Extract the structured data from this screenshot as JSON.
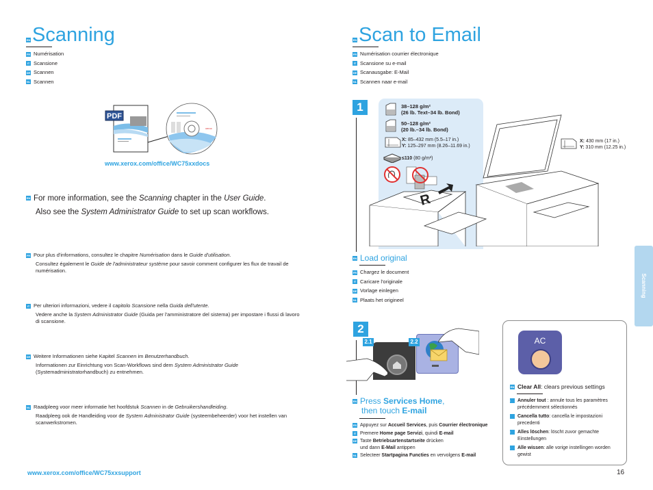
{
  "left": {
    "title_lang": "EN",
    "title": "Scanning",
    "translations": [
      {
        "lang": "FR",
        "text": "Numérisation"
      },
      {
        "lang": "IT",
        "text": "Scansione"
      },
      {
        "lang": "DE",
        "text": "Scannen"
      },
      {
        "lang": "NL",
        "text": "Scannen"
      }
    ],
    "pdf_label": "PDF",
    "docs_link": "www.xerox.com/office/WC75xxdocs",
    "info_en": {
      "lang": "EN",
      "line1_a": "For more information, see the ",
      "line1_i1": "Scanning",
      "line1_b": " chapter in the ",
      "line1_i2": "User Guide",
      "line1_c": ".",
      "line2_a": "Also see the ",
      "line2_i": "System Administrator Guide",
      "line2_b": " to set up scan workflows."
    },
    "info_fr": {
      "lang": "FR",
      "l1a": "Pour plus d'informations, consultez le chapitre ",
      "l1i1": "Numérisation",
      "l1b": " dans le ",
      "l1i2": "Guide d'utilisation",
      "l1c": ".",
      "l2a": "Consultez également le ",
      "l2i": "Guide de l'administrateur système",
      "l2b": " pour savoir comment configurer les flux de travail de numérisation."
    },
    "info_it": {
      "lang": "IT",
      "l1a": "Per ulteriori informazioni, vedere il capitolo ",
      "l1i1": "Scansione",
      "l1b": " nella ",
      "l1i2": "Guida dell'utente",
      "l1c": ".",
      "l2a": "Vedere anche la ",
      "l2i": "System Administrator Guide",
      "l2b": " (Guida per l'amministratore del sistema) per impostare i flussi di lavoro di scansione."
    },
    "info_de": {
      "lang": "DE",
      "l1a": "Weitere Informationen siehe Kapitel ",
      "l1i1": "Scannen",
      "l1b": " im ",
      "l1i2": "Benutzerhandbuch",
      "l1c": ".",
      "l2a": "Informationen zur Einrichtung von Scan-Workflows sind dem ",
      "l2i": "System Administrator Guide",
      "l2b": " (Systemadministratorhandbuch) zu entnehmen."
    },
    "info_nl": {
      "lang": "NL",
      "l1a": "Raadpleeg voor meer informatie het hoofdstuk ",
      "l1i1": "Scannen",
      "l1b": " in de ",
      "l1i2": "Gebruikershandleiding",
      "l1c": ".",
      "l2a": "Raadpleeg ook de Handleiding voor de ",
      "l2i": "System Administrator Guide",
      "l2b": " (systeembeheerder) voor het instellen van scanwerkstromen."
    },
    "support_link": "www.xerox.com/office/WC75xxsupport"
  },
  "right": {
    "title_lang": "EN",
    "title": "Scan to Email",
    "translations": [
      {
        "lang": "FR",
        "text": "Numérisation courrier électronique"
      },
      {
        "lang": "IT",
        "text": "Scansione su e-mail"
      },
      {
        "lang": "DE",
        "text": "Scanausgabe: E-Mail"
      },
      {
        "lang": "NL",
        "text": "Scannen naar e-mail"
      }
    ],
    "step1": {
      "number": "1",
      "paper1_line1": "38–128 g/m²",
      "paper1_line2": "(26 lb. Text–34 lb. Bond)",
      "paper2_line1": "50–128 g/m²",
      "paper2_line2": "(20 lb.–34 lb. Bond)",
      "size_x_label": "X:",
      "size_x": " 85–432 mm (5.5–17 in.)",
      "size_y_label": "Y:",
      "size_y": " 125–297 mm (8.26–11.69 in.)",
      "capacity_bold": "≤110",
      "capacity": " (80 g/m²)",
      "glass_x_label": "X:",
      "glass_x": " 430 mm (17 in.)",
      "glass_y_label": "Y:",
      "glass_y": " 310 mm (12.25 in.)",
      "heading_lang": "EN",
      "heading": "Load original",
      "translations": [
        {
          "lang": "FR",
          "text": "Chargez le document"
        },
        {
          "lang": "IT",
          "text": "Caricare l'originale"
        },
        {
          "lang": "DE",
          "text": "Vorlage einlegen"
        },
        {
          "lang": "NL",
          "text": "Plaats het origineel"
        }
      ]
    },
    "step2": {
      "number": "2",
      "badge_a": "2.1",
      "badge_b": "2.2",
      "heading_lang": "EN",
      "heading_a": "Press ",
      "heading_b": "Services Home",
      "heading_c": ",",
      "heading_d": "then touch ",
      "heading_e": "E-mail",
      "fr": {
        "lang": "FR",
        "a": "Appuyez sur ",
        "b": "Accueil Services",
        "c": ", puis ",
        "d": "Courrier électronique"
      },
      "it": {
        "lang": "IT",
        "a": "Premere ",
        "b": "Home page Servizi",
        "c": ", quindi ",
        "d": "E-mail"
      },
      "de": {
        "lang": "DE",
        "a": "Taste ",
        "b": "Betriebsartenstartseite",
        "c": " drücken",
        "d2a": "und dann ",
        "d2b": "E-Mail",
        "d2c": " antippen"
      },
      "nl": {
        "lang": "NL",
        "a": "Selecteer ",
        "b": "Startpagina Functies",
        "c": " en vervolgens ",
        "d": "E-mail"
      }
    },
    "clear_all": {
      "button_label": "AC",
      "en": {
        "lang": "EN",
        "bold": "Clear All",
        "text": ": clears previous settings"
      },
      "fr": {
        "lang": "FR",
        "bold": "Annuler tout",
        "text": " : annule tous les paramètres précédemment sélectionnés"
      },
      "it": {
        "lang": "IT",
        "bold": "Cancella tutto",
        "text": ": cancella le impostazioni precedenti"
      },
      "de": {
        "lang": "DE",
        "bold": "Alles löschen",
        "text": ": löscht zuvor gemachte Einstellungen"
      },
      "nl": {
        "lang": "NL",
        "bold": "Alle wissen",
        "text": ": alle vorige instellingen worden gewist"
      }
    },
    "side_tab": "Scanning",
    "page_number": "16"
  },
  "colors": {
    "accent": "#2ea3e0",
    "panel_bg": "#dcebf8",
    "side_tab": "#b3d7ef",
    "ac_button": "#5c5fa8"
  }
}
